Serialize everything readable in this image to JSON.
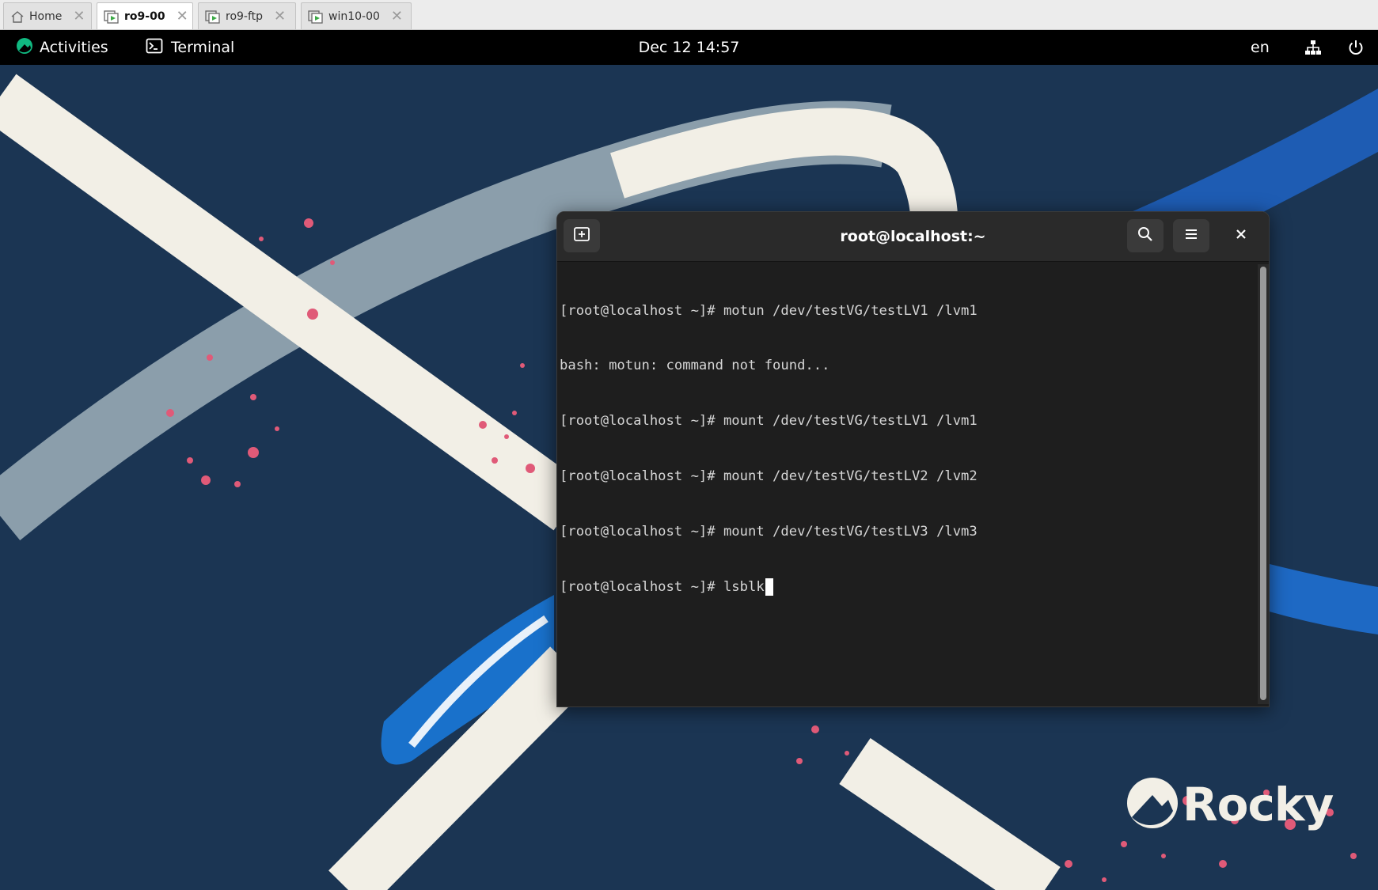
{
  "vm_tabs": [
    {
      "label": "Home",
      "icon": "home-icon",
      "active": false
    },
    {
      "label": "ro9-00",
      "icon": "vm-icon",
      "active": true
    },
    {
      "label": "ro9-ftp",
      "icon": "vm-icon",
      "active": false
    },
    {
      "label": "win10-00",
      "icon": "vm-icon",
      "active": false
    }
  ],
  "topbar": {
    "activities_label": "Activities",
    "app_label": "Terminal",
    "clock": "Dec 12  14:57",
    "language": "en"
  },
  "terminal": {
    "title": "root@localhost:~",
    "lines": [
      "[root@localhost ~]# motun /dev/testVG/testLV1 /lvm1",
      "bash: motun: command not found...",
      "[root@localhost ~]# mount /dev/testVG/testLV1 /lvm1",
      "[root@localhost ~]# mount /dev/testVG/testLV2 /lvm2",
      "[root@localhost ~]# mount /dev/testVG/testLV3 /lvm3",
      "[root@localhost ~]# lsblk"
    ]
  },
  "desktop": {
    "logo_text": "Rocky"
  },
  "colors": {
    "wallpaper_bg": "#1b3553",
    "ribbon_cream": "#f2efe6",
    "ribbon_gray": "#9fb0bb",
    "accent_blue": "#1f6fd0",
    "splatter_pink": "#e05a78",
    "terminal_bg": "#1e1e1e",
    "rocky_green": "#10b981"
  }
}
